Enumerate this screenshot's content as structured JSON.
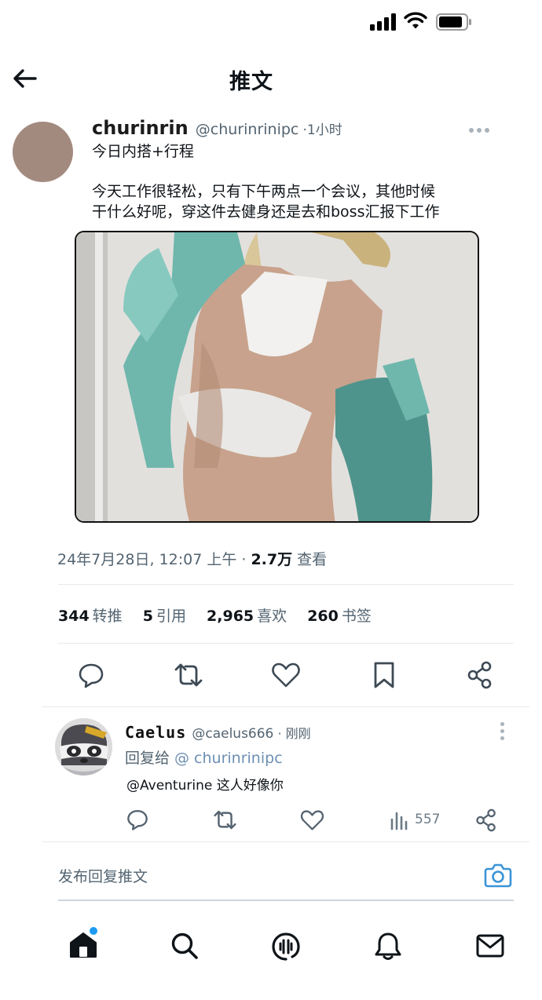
{
  "header": {
    "title": "推文"
  },
  "tweet": {
    "author_name": "churinrin",
    "author_handle": "@churinrinipc",
    "separator": "·",
    "time": "1小时",
    "text_title": "今日内搭+行程",
    "text_lines": [
      "今天工作很轻松，只有下午两点一个会议，其他时候",
      "干什么好呢，穿这件去健身还是去和boss汇报下工作"
    ],
    "date": "24年7月28日, 12:07 上午",
    "views_separator": " · ",
    "views_count": "2.7万",
    "views_label": "查看"
  },
  "stats": [
    {
      "count": "344",
      "label": "转推"
    },
    {
      "count": "5",
      "label": "引用"
    },
    {
      "count": "2,965",
      "label": "喜欢"
    },
    {
      "count": "260",
      "label": "书签"
    }
  ],
  "actions": [
    "reply-icon",
    "retweet-icon",
    "like-icon",
    "bookmark-icon",
    "share-icon"
  ],
  "reply": {
    "author_name": "Caelus",
    "author_handle": "@caelus666",
    "separator": "·",
    "time": "刚刚",
    "reply_to_label": "回复给",
    "reply_to_handle": "@ churinrinipc",
    "text": "@Aventurine 这人好像你",
    "views": "557"
  },
  "compose": {
    "placeholder": "发布回复推文"
  },
  "nav": [
    "home-icon",
    "search-icon",
    "spaces-icon",
    "notifications-icon",
    "messages-icon"
  ],
  "colors": {
    "accent": "#1d9bf0",
    "secondary_text": "#536471",
    "camera_icon": "#3a94d8",
    "avatar_main": "#a38a7f"
  }
}
